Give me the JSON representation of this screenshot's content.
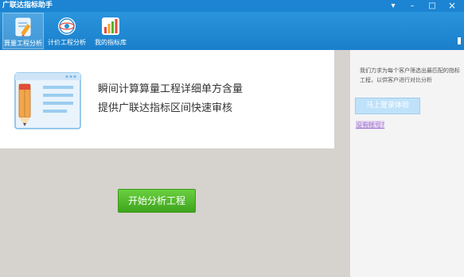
{
  "window": {
    "title": "广联达指标助手",
    "controls": {
      "menu": "▾",
      "minimize": "–",
      "maximize": "□",
      "close": "×"
    }
  },
  "toolbar": {
    "items": [
      {
        "label": "算量工程分析",
        "icon": "pencil-notebook-icon",
        "active": true
      },
      {
        "label": "计价工程分析",
        "icon": "globe-gear-icon",
        "active": false
      },
      {
        "label": "我的指标库",
        "icon": "bar-chart-icon",
        "active": false
      }
    ]
  },
  "banner": {
    "line1": "瞬间计算算量工程详细单方含量",
    "line2": "提供广联达指标区间快速审核",
    "illustration": "pencil-document-illustration"
  },
  "main": {
    "start_button": "开始分析工程"
  },
  "side": {
    "description": "我们力求为每个客户筛选出最匹配的指标工程，以供客户进行对比分析",
    "login_button": "马上登录体验",
    "no_account_link": "没有帐号?"
  },
  "colors": {
    "titlebar": "#1c84d2",
    "toolbar": "#1a7fcb",
    "start_button": "#4cb629",
    "login_button": "#bfe2fa",
    "background": "#d6d2cd"
  }
}
